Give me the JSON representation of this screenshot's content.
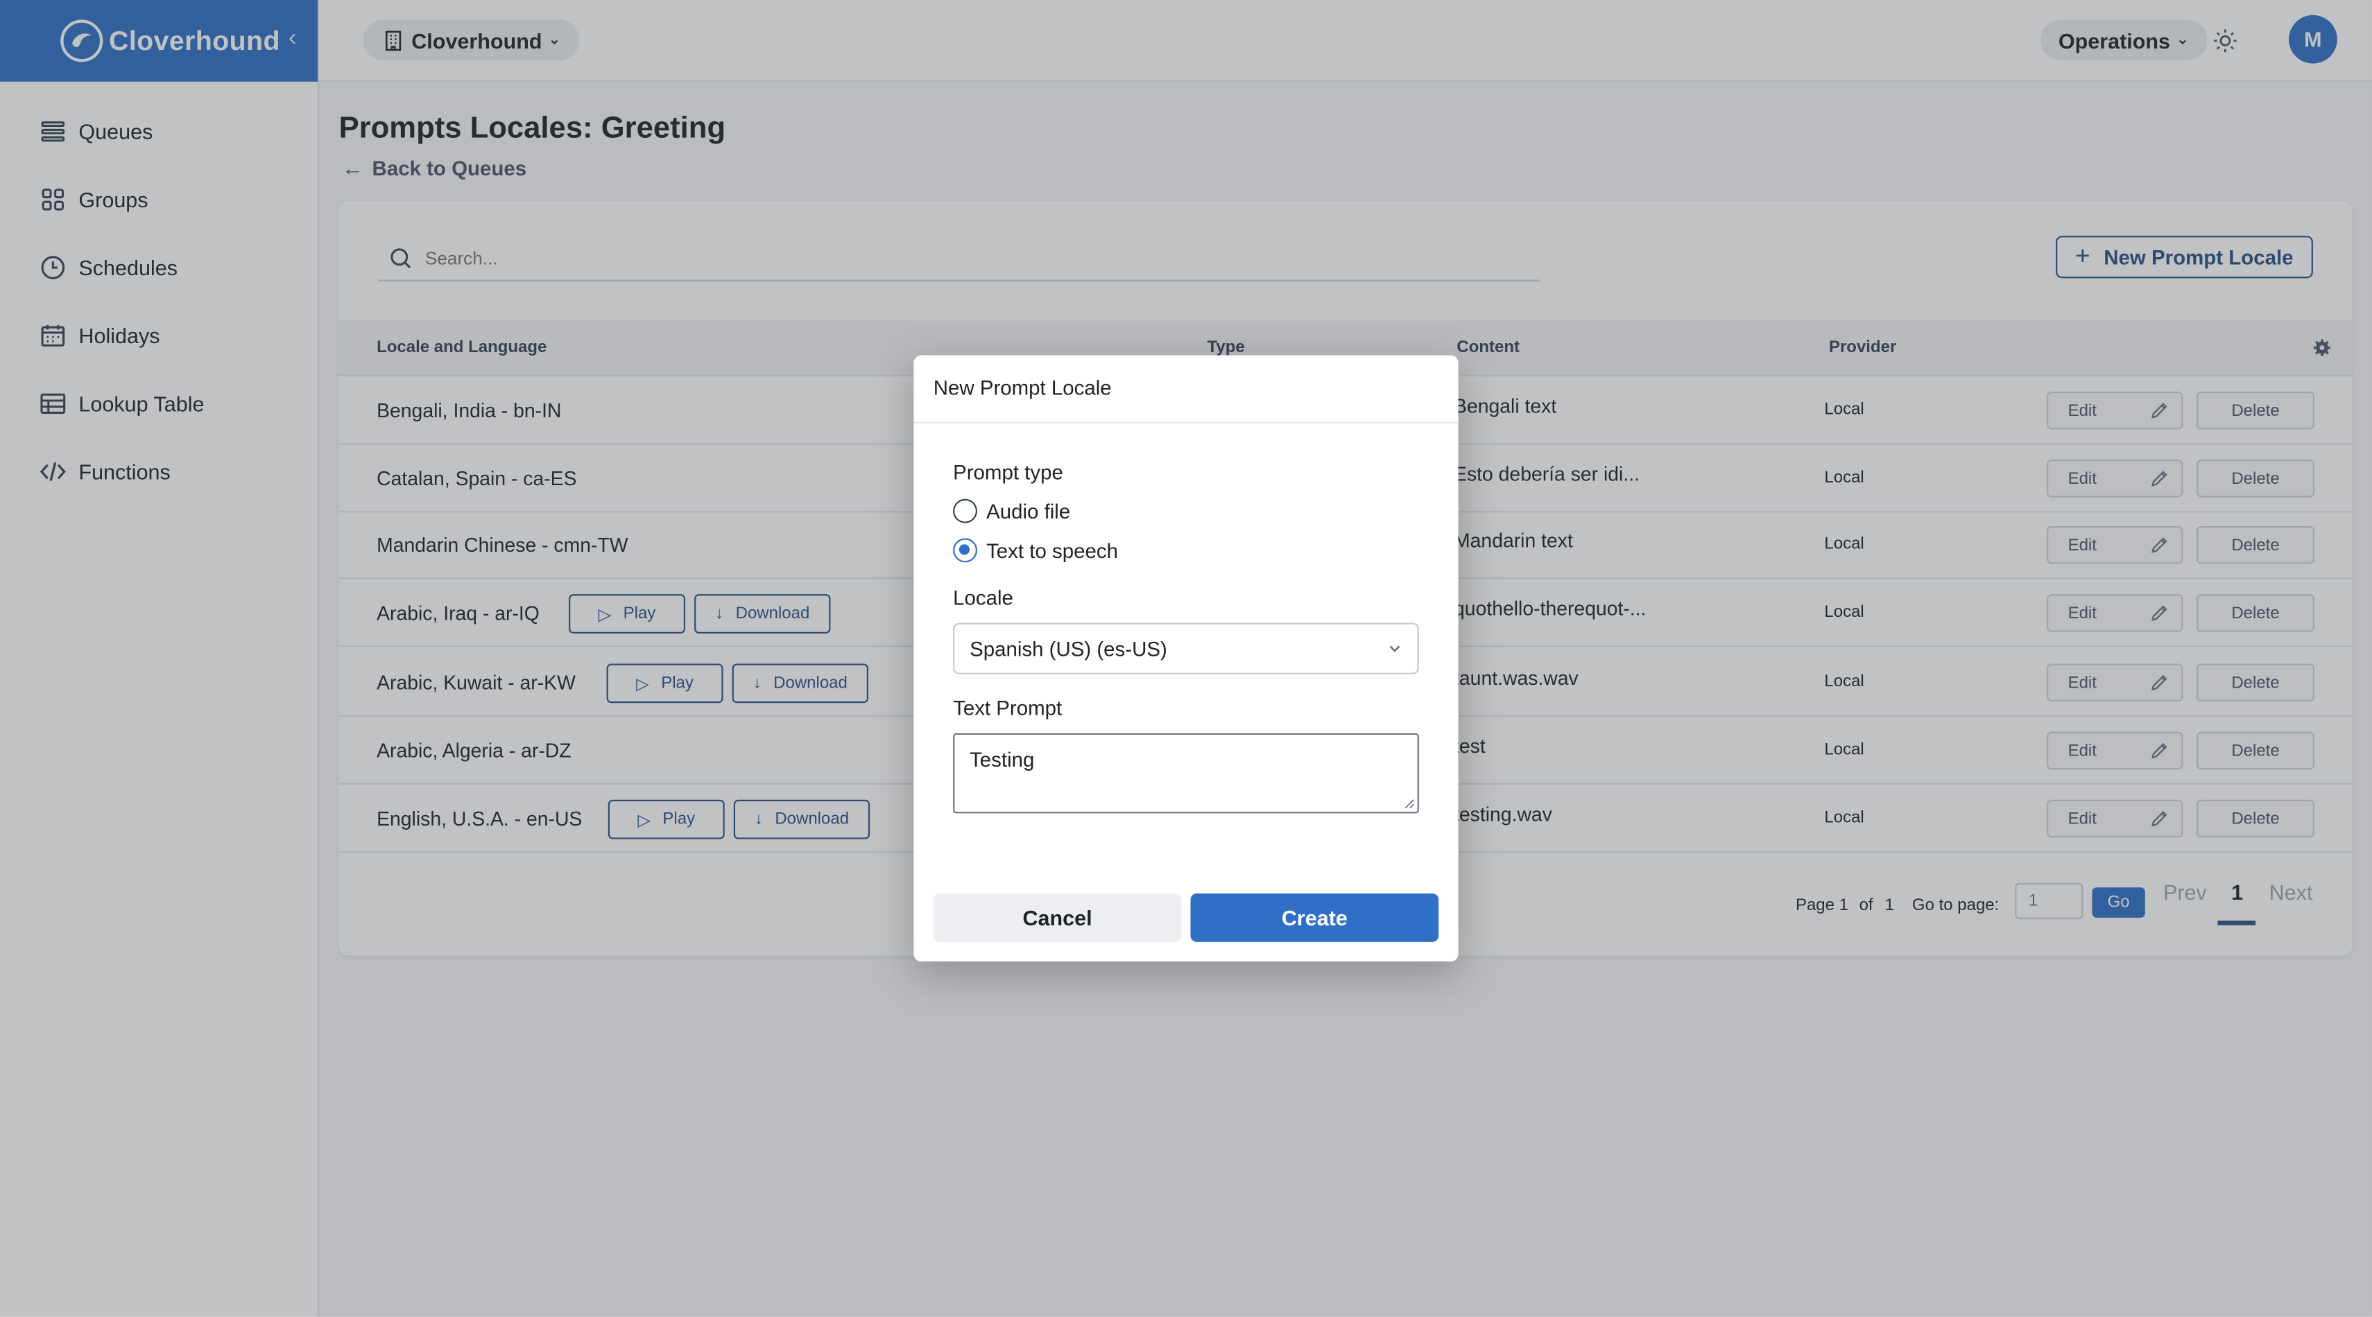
{
  "app": {
    "brand": "Cloverhound",
    "org_selector": "Cloverhound",
    "ops_selector": "Operations",
    "avatar_initial": "M",
    "accent_color": "#2f6fc6"
  },
  "sidebar": {
    "items": [
      {
        "label": "Queues",
        "icon": "list-icon"
      },
      {
        "label": "Groups",
        "icon": "grid-icon"
      },
      {
        "label": "Schedules",
        "icon": "clock-icon"
      },
      {
        "label": "Holidays",
        "icon": "calendar-icon"
      },
      {
        "label": "Lookup Table",
        "icon": "table-icon"
      },
      {
        "label": "Functions",
        "icon": "code-icon"
      }
    ]
  },
  "page": {
    "title": "Prompts Locales: Greeting",
    "back_label": "Back to Queues"
  },
  "toolbar": {
    "search_placeholder": "Search...",
    "new_label": "New Prompt Locale"
  },
  "table": {
    "columns": [
      "Locale and Language",
      "Type",
      "Content",
      "Provider"
    ],
    "rows": [
      {
        "locale": "Bengali, India - bn-IN",
        "content": "Bengali text",
        "provider": "Local",
        "audio": false
      },
      {
        "locale": "Catalan, Spain - ca-ES",
        "content": "Esto debería ser idi...",
        "provider": "Local",
        "audio": false
      },
      {
        "locale": "Mandarin Chinese - cmn-TW",
        "content": "Mandarin text",
        "provider": "Local",
        "audio": false
      },
      {
        "locale": "Arabic, Iraq - ar-IQ",
        "content": "quothello-therequot-...",
        "provider": "Local",
        "audio": true
      },
      {
        "locale": "Arabic, Kuwait - ar-KW",
        "content": "taunt.was.wav",
        "provider": "Local",
        "audio": true
      },
      {
        "locale": "Arabic, Algeria - ar-DZ",
        "content": "test",
        "provider": "Local",
        "audio": false
      },
      {
        "locale": "English, U.S.A. - en-US",
        "content": "testing.wav",
        "provider": "Local",
        "audio": true
      }
    ],
    "play_label": "Play",
    "download_label": "Download",
    "edit_label": "Edit",
    "delete_label": "Delete"
  },
  "pager": {
    "page_label": "Page 1",
    "of_label": "of",
    "total": "1",
    "goto_label": "Go to page:",
    "goto_value": "1",
    "go_label": "Go",
    "prev_label": "Prev",
    "current": "1",
    "next_label": "Next"
  },
  "modal": {
    "title": "New Prompt Locale",
    "prompt_type_label": "Prompt type",
    "option_audio": "Audio file",
    "option_tts": "Text to speech",
    "selected_option": "Text to speech",
    "locale_label": "Locale",
    "locale_value": "Spanish (US) (es-US)",
    "text_prompt_label": "Text Prompt",
    "text_prompt_value": "Testing",
    "cancel_label": "Cancel",
    "create_label": "Create"
  }
}
